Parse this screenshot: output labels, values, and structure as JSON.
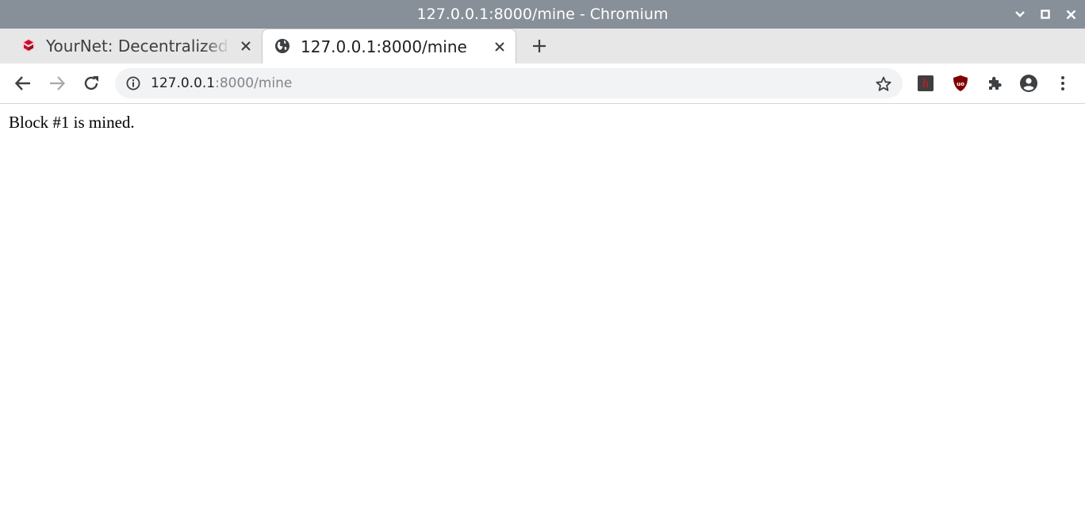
{
  "window": {
    "title": "127.0.0.1:8000/mine - Chromium",
    "titlebar_color": "#878f98"
  },
  "tabs": [
    {
      "label": "YourNet: Decentralized co",
      "icon": "yournet-logo-icon",
      "active": false
    },
    {
      "label": "127.0.0.1:8000/mine",
      "icon": "globe-icon",
      "active": true
    }
  ],
  "toolbar": {
    "url_host": "127.0.0.1",
    "url_rest": ":8000/mine"
  },
  "extensions": [
    {
      "name": "hypothesis-extension-icon",
      "label": "h",
      "color": "#bd1c2b"
    },
    {
      "name": "ublock-origin-icon",
      "label": "uo",
      "color": "#800000"
    },
    {
      "name": "extensions-puzzle-icon"
    },
    {
      "name": "profile-icon"
    },
    {
      "name": "menu-icon"
    }
  ],
  "page": {
    "message": "Block #1 is mined."
  }
}
